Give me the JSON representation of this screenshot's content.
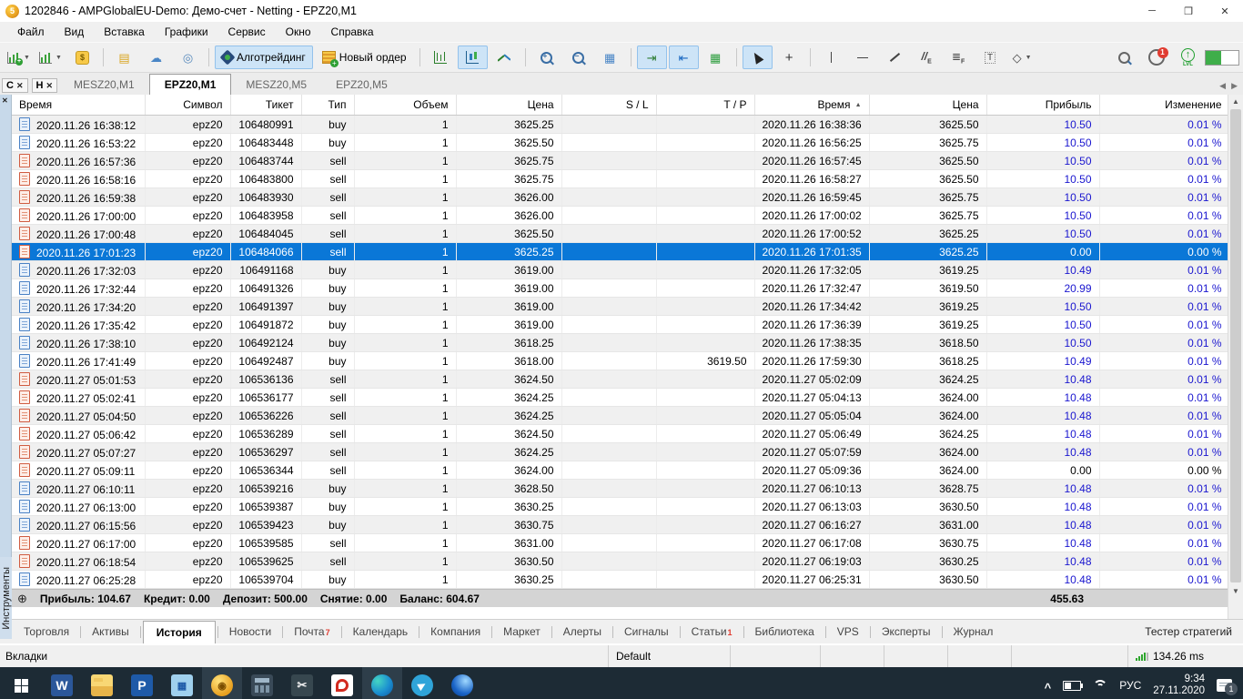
{
  "window": {
    "title": "1202846 - AMPGlobalEU-Demo: Демо-счет - Netting - EPZ20,M1"
  },
  "menu": {
    "items": [
      "Файл",
      "Вид",
      "Вставка",
      "Графики",
      "Сервис",
      "Окно",
      "Справка"
    ]
  },
  "toolbar": {
    "algo_trading_label": "Алготрейдинг",
    "new_order_label": "Новый ордер",
    "notification_count": "1",
    "lvl_label": "LVL"
  },
  "mini_panels": {
    "items": [
      "C",
      "H"
    ]
  },
  "chart_tabs": {
    "items": [
      {
        "label": "MESZ20,M1",
        "active": false
      },
      {
        "label": "EPZ20,M1",
        "active": true
      },
      {
        "label": "MESZ20,M5",
        "active": false
      },
      {
        "label": "EPZ20,M5",
        "active": false
      }
    ]
  },
  "sidebar": {
    "vertical_label": "Инструменты"
  },
  "history": {
    "columns": [
      "Время",
      "Символ",
      "Тикет",
      "Тип",
      "Объем",
      "Цена",
      "S / L",
      "T / P",
      "Время",
      "Цена",
      "Прибыль",
      "Изменение"
    ],
    "sort_column_index": 8,
    "rows": [
      {
        "open_time": "2020.11.26 16:38:12",
        "symbol": "epz20",
        "ticket": "106480991",
        "type": "buy",
        "volume": "1",
        "price": "3625.25",
        "sl": "",
        "tp": "",
        "close_time": "2020.11.26 16:38:36",
        "close_price": "3625.50",
        "profit": "10.50",
        "change": "0.01 %",
        "selected": false
      },
      {
        "open_time": "2020.11.26 16:53:22",
        "symbol": "epz20",
        "ticket": "106483448",
        "type": "buy",
        "volume": "1",
        "price": "3625.50",
        "sl": "",
        "tp": "",
        "close_time": "2020.11.26 16:56:25",
        "close_price": "3625.75",
        "profit": "10.50",
        "change": "0.01 %",
        "selected": false
      },
      {
        "open_time": "2020.11.26 16:57:36",
        "symbol": "epz20",
        "ticket": "106483744",
        "type": "sell",
        "volume": "1",
        "price": "3625.75",
        "sl": "",
        "tp": "",
        "close_time": "2020.11.26 16:57:45",
        "close_price": "3625.50",
        "profit": "10.50",
        "change": "0.01 %",
        "selected": false
      },
      {
        "open_time": "2020.11.26 16:58:16",
        "symbol": "epz20",
        "ticket": "106483800",
        "type": "sell",
        "volume": "1",
        "price": "3625.75",
        "sl": "",
        "tp": "",
        "close_time": "2020.11.26 16:58:27",
        "close_price": "3625.50",
        "profit": "10.50",
        "change": "0.01 %",
        "selected": false
      },
      {
        "open_time": "2020.11.26 16:59:38",
        "symbol": "epz20",
        "ticket": "106483930",
        "type": "sell",
        "volume": "1",
        "price": "3626.00",
        "sl": "",
        "tp": "",
        "close_time": "2020.11.26 16:59:45",
        "close_price": "3625.75",
        "profit": "10.50",
        "change": "0.01 %",
        "selected": false
      },
      {
        "open_time": "2020.11.26 17:00:00",
        "symbol": "epz20",
        "ticket": "106483958",
        "type": "sell",
        "volume": "1",
        "price": "3626.00",
        "sl": "",
        "tp": "",
        "close_time": "2020.11.26 17:00:02",
        "close_price": "3625.75",
        "profit": "10.50",
        "change": "0.01 %",
        "selected": false
      },
      {
        "open_time": "2020.11.26 17:00:48",
        "symbol": "epz20",
        "ticket": "106484045",
        "type": "sell",
        "volume": "1",
        "price": "3625.50",
        "sl": "",
        "tp": "",
        "close_time": "2020.11.26 17:00:52",
        "close_price": "3625.25",
        "profit": "10.50",
        "change": "0.01 %",
        "selected": false
      },
      {
        "open_time": "2020.11.26 17:01:23",
        "symbol": "epz20",
        "ticket": "106484066",
        "type": "sell",
        "volume": "1",
        "price": "3625.25",
        "sl": "",
        "tp": "",
        "close_time": "2020.11.26 17:01:35",
        "close_price": "3625.25",
        "profit": "0.00",
        "change": "0.00 %",
        "selected": true
      },
      {
        "open_time": "2020.11.26 17:32:03",
        "symbol": "epz20",
        "ticket": "106491168",
        "type": "buy",
        "volume": "1",
        "price": "3619.00",
        "sl": "",
        "tp": "",
        "close_time": "2020.11.26 17:32:05",
        "close_price": "3619.25",
        "profit": "10.49",
        "change": "0.01 %",
        "selected": false
      },
      {
        "open_time": "2020.11.26 17:32:44",
        "symbol": "epz20",
        "ticket": "106491326",
        "type": "buy",
        "volume": "1",
        "price": "3619.00",
        "sl": "",
        "tp": "",
        "close_time": "2020.11.26 17:32:47",
        "close_price": "3619.50",
        "profit": "20.99",
        "change": "0.01 %",
        "selected": false
      },
      {
        "open_time": "2020.11.26 17:34:20",
        "symbol": "epz20",
        "ticket": "106491397",
        "type": "buy",
        "volume": "1",
        "price": "3619.00",
        "sl": "",
        "tp": "",
        "close_time": "2020.11.26 17:34:42",
        "close_price": "3619.25",
        "profit": "10.50",
        "change": "0.01 %",
        "selected": false
      },
      {
        "open_time": "2020.11.26 17:35:42",
        "symbol": "epz20",
        "ticket": "106491872",
        "type": "buy",
        "volume": "1",
        "price": "3619.00",
        "sl": "",
        "tp": "",
        "close_time": "2020.11.26 17:36:39",
        "close_price": "3619.25",
        "profit": "10.50",
        "change": "0.01 %",
        "selected": false
      },
      {
        "open_time": "2020.11.26 17:38:10",
        "symbol": "epz20",
        "ticket": "106492124",
        "type": "buy",
        "volume": "1",
        "price": "3618.25",
        "sl": "",
        "tp": "",
        "close_time": "2020.11.26 17:38:35",
        "close_price": "3618.50",
        "profit": "10.50",
        "change": "0.01 %",
        "selected": false
      },
      {
        "open_time": "2020.11.26 17:41:49",
        "symbol": "epz20",
        "ticket": "106492487",
        "type": "buy",
        "volume": "1",
        "price": "3618.00",
        "sl": "",
        "tp": "3619.50",
        "close_time": "2020.11.26 17:59:30",
        "close_price": "3618.25",
        "profit": "10.49",
        "change": "0.01 %",
        "selected": false
      },
      {
        "open_time": "2020.11.27 05:01:53",
        "symbol": "epz20",
        "ticket": "106536136",
        "type": "sell",
        "volume": "1",
        "price": "3624.50",
        "sl": "",
        "tp": "",
        "close_time": "2020.11.27 05:02:09",
        "close_price": "3624.25",
        "profit": "10.48",
        "change": "0.01 %",
        "selected": false
      },
      {
        "open_time": "2020.11.27 05:02:41",
        "symbol": "epz20",
        "ticket": "106536177",
        "type": "sell",
        "volume": "1",
        "price": "3624.25",
        "sl": "",
        "tp": "",
        "close_time": "2020.11.27 05:04:13",
        "close_price": "3624.00",
        "profit": "10.48",
        "change": "0.01 %",
        "selected": false
      },
      {
        "open_time": "2020.11.27 05:04:50",
        "symbol": "epz20",
        "ticket": "106536226",
        "type": "sell",
        "volume": "1",
        "price": "3624.25",
        "sl": "",
        "tp": "",
        "close_time": "2020.11.27 05:05:04",
        "close_price": "3624.00",
        "profit": "10.48",
        "change": "0.01 %",
        "selected": false
      },
      {
        "open_time": "2020.11.27 05:06:42",
        "symbol": "epz20",
        "ticket": "106536289",
        "type": "sell",
        "volume": "1",
        "price": "3624.50",
        "sl": "",
        "tp": "",
        "close_time": "2020.11.27 05:06:49",
        "close_price": "3624.25",
        "profit": "10.48",
        "change": "0.01 %",
        "selected": false
      },
      {
        "open_time": "2020.11.27 05:07:27",
        "symbol": "epz20",
        "ticket": "106536297",
        "type": "sell",
        "volume": "1",
        "price": "3624.25",
        "sl": "",
        "tp": "",
        "close_time": "2020.11.27 05:07:59",
        "close_price": "3624.00",
        "profit": "10.48",
        "change": "0.01 %",
        "selected": false
      },
      {
        "open_time": "2020.11.27 05:09:11",
        "symbol": "epz20",
        "ticket": "106536344",
        "type": "sell",
        "volume": "1",
        "price": "3624.00",
        "sl": "",
        "tp": "",
        "close_time": "2020.11.27 05:09:36",
        "close_price": "3624.00",
        "profit": "0.00",
        "change": "0.00 %",
        "selected": false
      },
      {
        "open_time": "2020.11.27 06:10:11",
        "symbol": "epz20",
        "ticket": "106539216",
        "type": "buy",
        "volume": "1",
        "price": "3628.50",
        "sl": "",
        "tp": "",
        "close_time": "2020.11.27 06:10:13",
        "close_price": "3628.75",
        "profit": "10.48",
        "change": "0.01 %",
        "selected": false
      },
      {
        "open_time": "2020.11.27 06:13:00",
        "symbol": "epz20",
        "ticket": "106539387",
        "type": "buy",
        "volume": "1",
        "price": "3630.25",
        "sl": "",
        "tp": "",
        "close_time": "2020.11.27 06:13:03",
        "close_price": "3630.50",
        "profit": "10.48",
        "change": "0.01 %",
        "selected": false
      },
      {
        "open_time": "2020.11.27 06:15:56",
        "symbol": "epz20",
        "ticket": "106539423",
        "type": "buy",
        "volume": "1",
        "price": "3630.75",
        "sl": "",
        "tp": "",
        "close_time": "2020.11.27 06:16:27",
        "close_price": "3631.00",
        "profit": "10.48",
        "change": "0.01 %",
        "selected": false
      },
      {
        "open_time": "2020.11.27 06:17:00",
        "symbol": "epz20",
        "ticket": "106539585",
        "type": "sell",
        "volume": "1",
        "price": "3631.00",
        "sl": "",
        "tp": "",
        "close_time": "2020.11.27 06:17:08",
        "close_price": "3630.75",
        "profit": "10.48",
        "change": "0.01 %",
        "selected": false
      },
      {
        "open_time": "2020.11.27 06:18:54",
        "symbol": "epz20",
        "ticket": "106539625",
        "type": "sell",
        "volume": "1",
        "price": "3630.50",
        "sl": "",
        "tp": "",
        "close_time": "2020.11.27 06:19:03",
        "close_price": "3630.25",
        "profit": "10.48",
        "change": "0.01 %",
        "selected": false
      },
      {
        "open_time": "2020.11.27 06:25:28",
        "symbol": "epz20",
        "ticket": "106539704",
        "type": "buy",
        "volume": "1",
        "price": "3630.25",
        "sl": "",
        "tp": "",
        "close_time": "2020.11.27 06:25:31",
        "close_price": "3630.50",
        "profit": "10.48",
        "change": "0.01 %",
        "selected": false
      }
    ]
  },
  "summary": {
    "items": [
      {
        "label": "Прибыль:",
        "value": "104.67"
      },
      {
        "label": "Кредит:",
        "value": "0.00"
      },
      {
        "label": "Депозит:",
        "value": "500.00"
      },
      {
        "label": "Снятие:",
        "value": "0.00"
      },
      {
        "label": "Баланс:",
        "value": "604.67"
      }
    ],
    "right_value": "455.63"
  },
  "bottom_tabs": {
    "items": [
      {
        "label": "Торговля",
        "active": false
      },
      {
        "label": "Активы",
        "active": false
      },
      {
        "label": "История",
        "active": true
      },
      {
        "label": "Новости",
        "active": false
      },
      {
        "label": "Почта",
        "active": false,
        "badge": "7"
      },
      {
        "label": "Календарь",
        "active": false
      },
      {
        "label": "Компания",
        "active": false
      },
      {
        "label": "Маркет",
        "active": false
      },
      {
        "label": "Алерты",
        "active": false
      },
      {
        "label": "Сигналы",
        "active": false
      },
      {
        "label": "Статьи",
        "active": false,
        "badge": "1"
      },
      {
        "label": "Библиотека",
        "active": false
      },
      {
        "label": "VPS",
        "active": false
      },
      {
        "label": "Эксперты",
        "active": false
      },
      {
        "label": "Журнал",
        "active": false
      }
    ],
    "right_label": "Тестер стратегий"
  },
  "status_bar": {
    "hint": "Вкладки",
    "profile": "Default",
    "latency": "134.26 ms"
  },
  "taskbar": {
    "apps": [
      {
        "name": "word",
        "glyph": "W",
        "active": false
      },
      {
        "name": "file-explorer",
        "glyph": "",
        "active": false
      },
      {
        "name": "p-app",
        "glyph": "P",
        "active": false
      },
      {
        "name": "report-app",
        "glyph": "▦",
        "active": false
      },
      {
        "name": "metatrader5",
        "glyph": "◉",
        "active": true
      },
      {
        "name": "calculator",
        "glyph": "",
        "active": false
      },
      {
        "name": "snipping-tool",
        "glyph": "✂",
        "active": false
      },
      {
        "name": "red-app",
        "glyph": "",
        "active": false
      },
      {
        "name": "edge",
        "glyph": "",
        "active": true
      },
      {
        "name": "telegram",
        "glyph": "▶",
        "active": false
      },
      {
        "name": "blue-app",
        "glyph": "",
        "active": false
      }
    ],
    "language": "РУС",
    "clock_time": "9:34",
    "clock_date": "27.11.2020",
    "notification_count": "1"
  },
  "colors": {
    "selection": "#0a77d7",
    "profit_text": "#1a16cf",
    "buy_icon": "#4a81c4",
    "sell_icon": "#d05c41",
    "taskbar_bg": "#1d2b35"
  }
}
